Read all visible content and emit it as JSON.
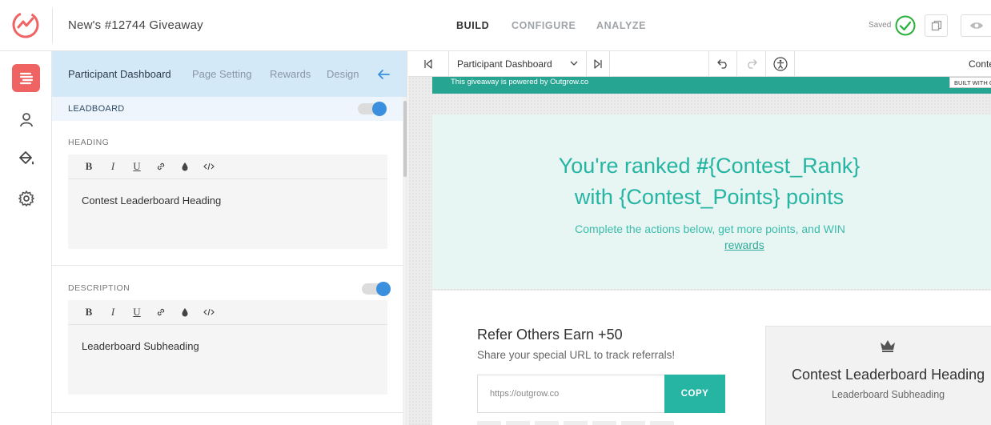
{
  "app": {
    "title": "New's #12744 Giveaway",
    "nav_tabs": [
      {
        "label": "BUILD",
        "active": true
      },
      {
        "label": "CONFIGURE",
        "active": false
      },
      {
        "label": "ANALYZE",
        "active": false
      }
    ],
    "saved_label": "Saved",
    "accent_color": "#ef6463",
    "brand_teal": "#27b5a3",
    "toggle_blue": "#3a8fde"
  },
  "rail": {
    "icons": [
      "layout-icon",
      "user-icon",
      "paint-bucket-icon",
      "gear-icon"
    ],
    "active_index": 0
  },
  "panel": {
    "tabs": [
      {
        "label": "Participant Dashboard",
        "active": true
      },
      {
        "label": "Page Setting",
        "active": false
      },
      {
        "label": "Rewards",
        "active": false
      },
      {
        "label": "Design",
        "active": false
      }
    ],
    "section_label": "LEADBOARD",
    "section_enabled": true,
    "heading_label": "HEADING",
    "heading_value": "Contest Leaderboard Heading",
    "description_label": "DESCRIPTION",
    "description_enabled": true,
    "description_value": "Leaderboard Subheading",
    "toolbar_buttons": [
      "B",
      "I",
      "U",
      "link-icon",
      "droplet-icon",
      "code-icon"
    ]
  },
  "preview_toolbar": {
    "page_select": "Participant Dashboard",
    "truncated_label": "Conte"
  },
  "preview": {
    "banner_text": "This giveaway is powered by Outgrow.co",
    "built_badge": "BUILT WITH OUTGROW",
    "hero_line1_prefix": "You're ranked ",
    "hero_line1_hash": "#",
    "hero_line1_var": "{Contest_Rank}",
    "hero_line2": "with {Contest_Points} points",
    "hero_sub": "Complete the actions below, get more points, and WIN",
    "hero_link": "rewards",
    "refer_title": "Refer Others Earn +50",
    "refer_sub": "Share your special URL to track referrals!",
    "url_value": "https://outgrow.co",
    "copy_label": "COPY",
    "leaderboard_heading": "Contest Leaderboard Heading",
    "leaderboard_subheading": "Leaderboard Subheading"
  }
}
